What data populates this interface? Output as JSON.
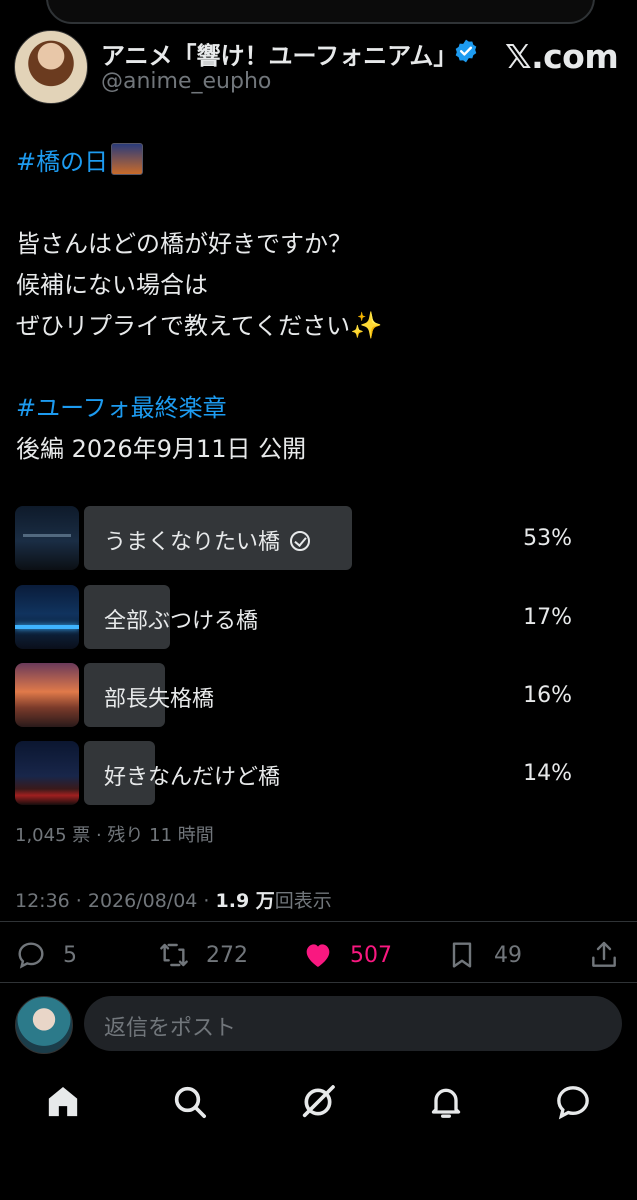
{
  "header": {
    "display_name": "アニメ「響け！ユーフォニアム」...",
    "handle": "@anime_eupho",
    "brand": "𝕏.com"
  },
  "tweet": {
    "hashtag1": "#橋の日",
    "line1": "皆さんはどの橋が好きですか？",
    "line2": "候補にない場合は",
    "line3": "ぜひリプライで教えてください",
    "sparkle": "✨",
    "hashtag2": "#ユーフォ最終楽章",
    "line4": "後編 2026年9月11日 公開"
  },
  "poll": {
    "options": [
      {
        "label": "うまくなりたい橋",
        "percent": "53%",
        "value": 53,
        "selected": true
      },
      {
        "label": "全部ぶつける橋",
        "percent": "17%",
        "value": 17,
        "selected": false
      },
      {
        "label": "部長失格橋",
        "percent": "16%",
        "value": 16,
        "selected": false
      },
      {
        "label": "好きなんだけど橋",
        "percent": "14%",
        "value": 14,
        "selected": false
      }
    ],
    "summary": "1,045 票 · 残り 11 時間"
  },
  "meta": {
    "time": "12:36 · 2026/08/04 · ",
    "views_count": "1.9 万",
    "views_label": "回表示"
  },
  "actions": {
    "replies": "5",
    "reposts": "272",
    "likes": "507",
    "bookmarks": "49"
  },
  "reply": {
    "placeholder": "返信をポスト"
  },
  "colors": {
    "accent": "#1d9bf0",
    "like": "#f91880",
    "muted": "#71767b",
    "poll_bar": "#333639"
  }
}
